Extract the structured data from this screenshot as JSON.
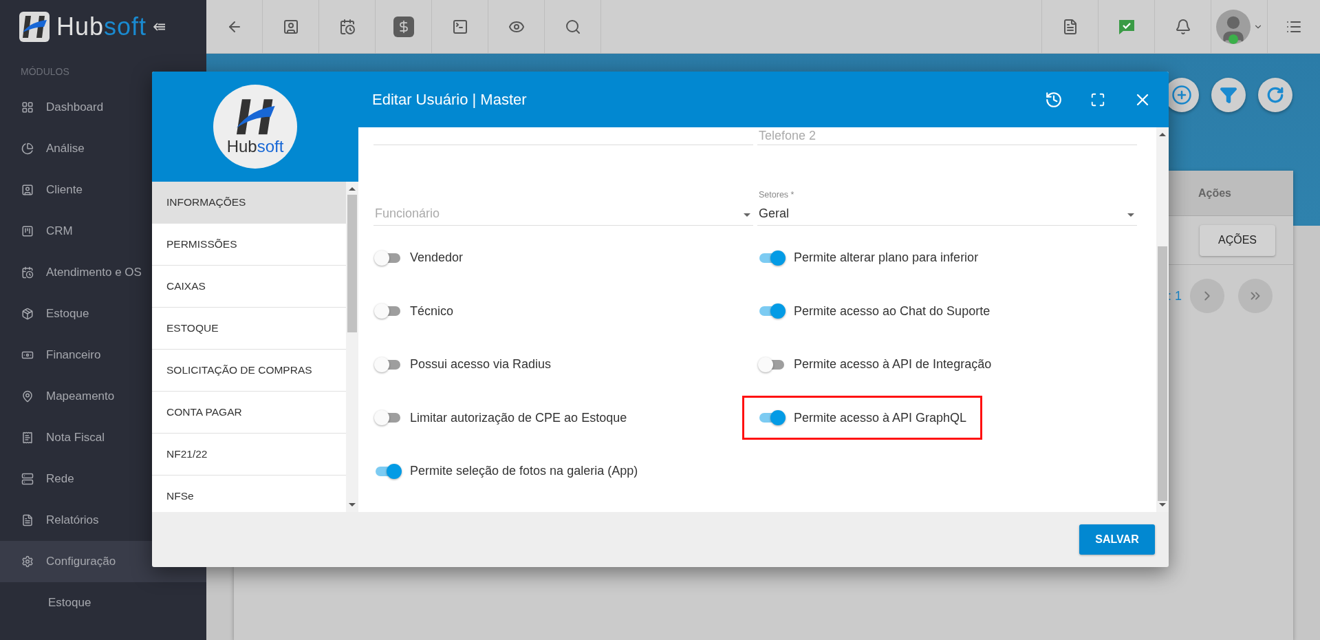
{
  "logo": {
    "parts": [
      "Hub",
      "soft"
    ]
  },
  "sidebar": {
    "heading": "MÓDULOS",
    "items": [
      {
        "label": "Dashboard",
        "selected": false
      },
      {
        "label": "Análise",
        "selected": false
      },
      {
        "label": "Cliente",
        "selected": false
      },
      {
        "label": "CRM",
        "selected": false
      },
      {
        "label": "Atendimento e OS",
        "selected": false
      },
      {
        "label": "Estoque",
        "selected": false
      },
      {
        "label": "Financeiro",
        "selected": false
      },
      {
        "label": "Mapeamento",
        "selected": false
      },
      {
        "label": "Nota Fiscal",
        "selected": false
      },
      {
        "label": "Rede",
        "selected": false
      },
      {
        "label": "Relatórios",
        "selected": false
      },
      {
        "label": "Configuração",
        "selected": true,
        "children": [
          {
            "label": "Estoque"
          }
        ]
      }
    ]
  },
  "background": {
    "table_header": "Ações",
    "actions_button": "AÇÕES",
    "page_text": ": 1"
  },
  "modal": {
    "title": "Editar Usuário | Master",
    "logo_parts": [
      "Hub",
      "soft"
    ],
    "menu": [
      {
        "label": "INFORMAÇÕES",
        "selected": true
      },
      {
        "label": "PERMISSÕES",
        "selected": false
      },
      {
        "label": "CAIXAS",
        "selected": false
      },
      {
        "label": "ESTOQUE",
        "selected": false
      },
      {
        "label": "SOLICITAÇÃO DE COMPRAS",
        "selected": false
      },
      {
        "label": "CONTA PAGAR",
        "selected": false
      },
      {
        "label": "NF21/22",
        "selected": false
      },
      {
        "label": "NFSe",
        "selected": false
      }
    ],
    "fields": [
      {
        "placeholder": "Telefone 2"
      },
      {
        "placeholder": "Funcionário"
      },
      {
        "label": "Setores *",
        "value": "Geral"
      }
    ],
    "left_toggles": [
      {
        "label": "Vendedor",
        "on": false
      },
      {
        "label": "Técnico",
        "on": false
      },
      {
        "label": "Possui acesso via Radius",
        "on": false
      },
      {
        "label": "Limitar autorização de CPE ao Estoque",
        "on": false
      },
      {
        "label": "Permite seleção de fotos na galeria (App)",
        "on": true
      }
    ],
    "right_toggles": [
      {
        "label": "Permite alterar plano para inferior",
        "on": true,
        "highlighted": false
      },
      {
        "label": "Permite acesso ao Chat do Suporte",
        "on": true,
        "highlighted": false
      },
      {
        "label": "Permite acesso à API de Integração",
        "on": false,
        "highlighted": false
      },
      {
        "label": "Permite acesso à API GraphQL",
        "on": true,
        "highlighted": true
      }
    ],
    "save_button": "SALVAR"
  }
}
